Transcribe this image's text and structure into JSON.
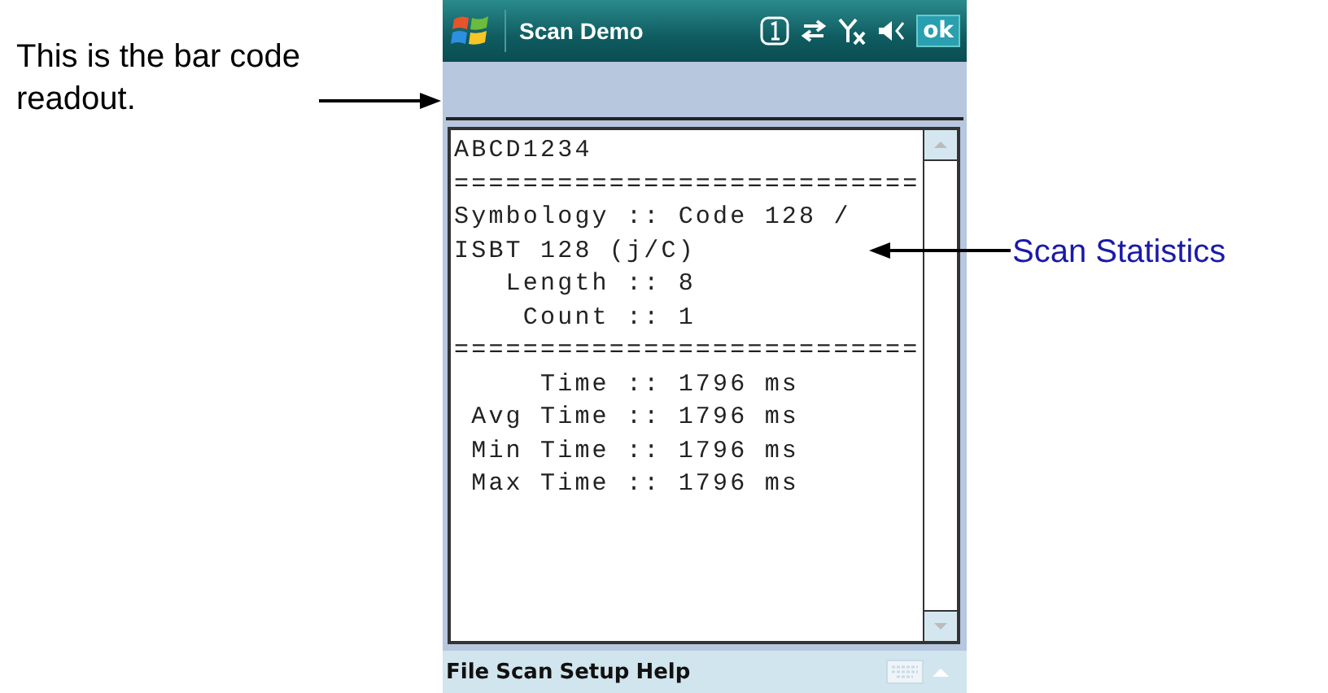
{
  "annotations": [
    {
      "kind": "left",
      "text": "This is the bar code readout."
    },
    {
      "kind": "right",
      "text": "Scan Statistics"
    }
  ],
  "window": {
    "title": "Scan Demo",
    "ok_label": "ok"
  },
  "readout": {
    "lines": [
      "ABCD1234",
      "===========================",
      "Symbology :: Code 128 /",
      "ISBT 128 (j/C)",
      "   Length :: 8",
      "    Count :: 1",
      "===========================",
      "     Time :: 1796 ms",
      " Avg Time :: 1796 ms",
      " Min Time :: 1796 ms",
      " Max Time :: 1796 ms"
    ]
  },
  "menu_bar": {
    "items": [
      "File",
      "Scan",
      "Setup",
      "Help"
    ]
  }
}
